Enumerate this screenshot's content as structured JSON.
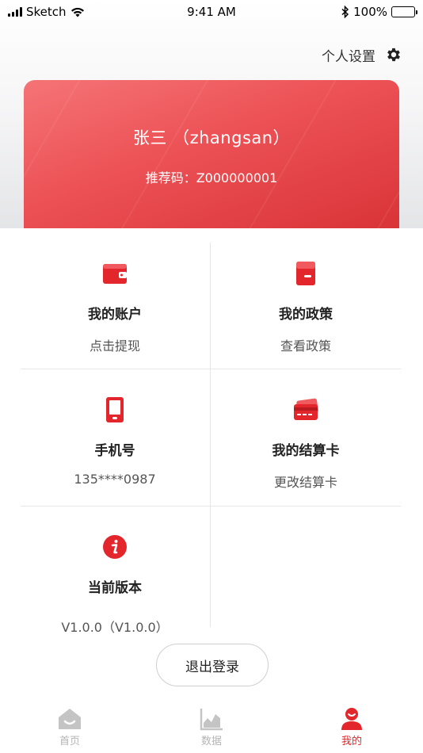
{
  "status_bar": {
    "carrier": "Sketch",
    "time": "9:41 AM",
    "battery": "100%"
  },
  "header": {
    "settings_label": "个人设置"
  },
  "profile": {
    "name": "张三 （zhangsan）",
    "referral": "推荐码：Z000000001"
  },
  "menu": {
    "account": {
      "title": "我的账户",
      "sub": "点击提现",
      "icon": "wallet-icon"
    },
    "policy": {
      "title": "我的政策",
      "sub": "查看政策",
      "icon": "policy-icon"
    },
    "phone": {
      "title": "手机号",
      "sub": "135****0987",
      "icon": "phone-icon"
    },
    "card": {
      "title": "我的结算卡",
      "sub": "更改结算卡",
      "icon": "bank-card-icon"
    },
    "version": {
      "title": "当前版本",
      "sub": "V1.0.0（V1.0.0）",
      "icon": "info-icon"
    }
  },
  "logout_label": "退出登录",
  "tabs": [
    {
      "label": "首页",
      "icon": "home-icon",
      "active": false
    },
    {
      "label": "数据",
      "icon": "chart-icon",
      "active": false
    },
    {
      "label": "我的",
      "icon": "user-icon",
      "active": true
    }
  ],
  "colors": {
    "accent": "#e3262b",
    "card_gradient_start": "#f57476",
    "card_gradient_end": "#d93438"
  }
}
